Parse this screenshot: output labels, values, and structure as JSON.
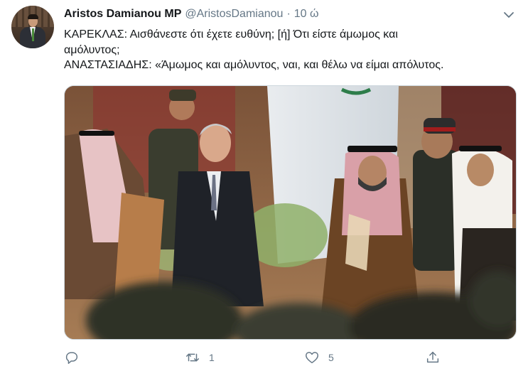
{
  "tweet": {
    "author_name": "Aristos Damianou MP",
    "handle": "@AristosDamianou",
    "separator": "·",
    "time": "10 ώ",
    "lines": [
      "ΚΑΡΕΚΛΑΣ: Αισθάνεστε ότι έχετε ευθύνη; [ή] Ότι είστε άμωμος και",
      "αμόλυντος;",
      "ΑΝΑΣΤΑΣΙΑΔΗΣ: «Άμωμος και αμόλυντος, ναι, και θέλω να είμαι απόλυτος."
    ]
  },
  "actions": {
    "reply": {
      "icon": "reply-icon",
      "count": ""
    },
    "retweet": {
      "icon": "retweet-icon",
      "count": "1"
    },
    "like": {
      "icon": "heart-icon",
      "count": "5"
    },
    "share": {
      "icon": "share-icon",
      "count": ""
    }
  },
  "colors": {
    "text": "#14171a",
    "secondary": "#657786",
    "border": "#ccd6dd"
  }
}
